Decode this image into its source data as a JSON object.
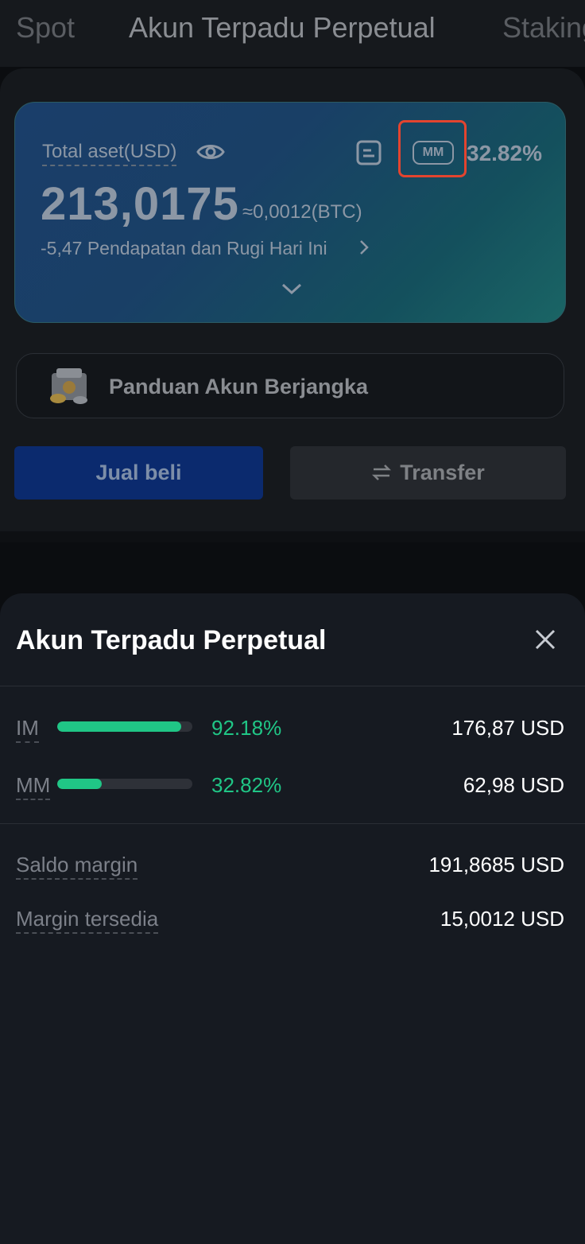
{
  "tabs": [
    {
      "label": "Spot"
    },
    {
      "label": "Akun Terpadu Perpetual"
    },
    {
      "label": "Staking"
    }
  ],
  "card": {
    "total_label": "Total aset(USD)",
    "mm_chip": "MM",
    "mm_ratio": "32.82%",
    "total_value": "213,0175",
    "btc_value": "≈0,0012(BTC)",
    "pnl": "-5,47  Pendapatan dan Rugi Hari Ini"
  },
  "guide": {
    "label": "Panduan Akun Berjangka"
  },
  "actions": {
    "trade": "Jual beli",
    "transfer": "Transfer"
  },
  "colors": {
    "accent_green": "#20c686",
    "highlight_red": "#e3442f",
    "trade_blue": "#0b2a6e"
  },
  "sheet": {
    "title": "Akun Terpadu Perpetual",
    "margin_rows": [
      {
        "label": "IM",
        "percent": "92.18%",
        "fill": 0.92,
        "value": "176,87 USD"
      },
      {
        "label": "MM",
        "percent": "32.82%",
        "fill": 0.33,
        "value": "62,98 USD"
      }
    ],
    "balance_rows": [
      {
        "label": "Saldo margin",
        "value": "191,8685 USD"
      },
      {
        "label": "Margin tersedia",
        "value": "15,0012 USD"
      }
    ]
  }
}
